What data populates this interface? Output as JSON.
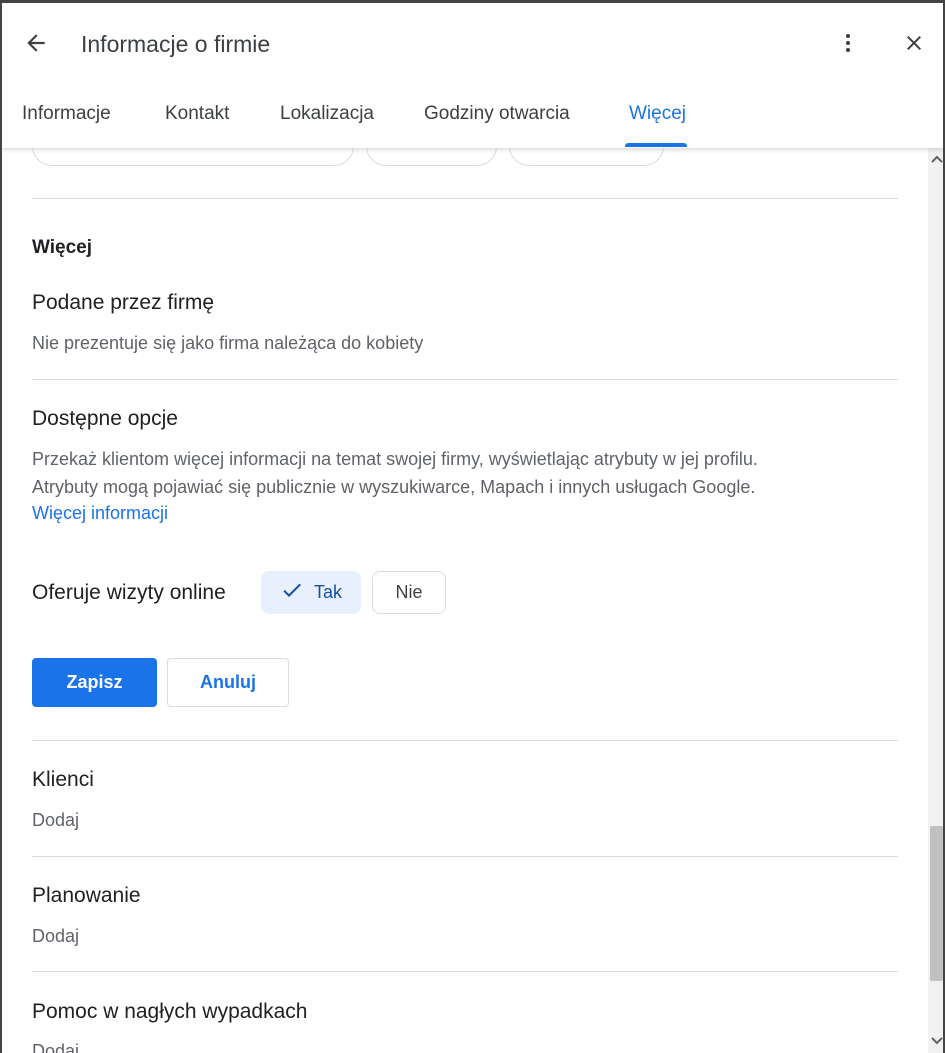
{
  "header": {
    "title": "Informacje o firmie"
  },
  "tabs": [
    {
      "label": "Informacje"
    },
    {
      "label": "Kontakt"
    },
    {
      "label": "Lokalizacja"
    },
    {
      "label": "Godziny otwarcia"
    },
    {
      "label": "Więcej",
      "active": true
    }
  ],
  "more_section": {
    "heading": "Więcej",
    "from_business": {
      "title": "Podane przez firmę",
      "value": "Nie prezentuje się jako firma należąca do kobiety"
    },
    "available_options": {
      "title": "Dostępne opcje",
      "description_line1": "Przekaż klientom więcej informacji na temat swojej firmy, wyświetlając atrybuty w jej profilu.",
      "description_line2": "Atrybuty mogą pojawiać się publicznie w wyszukiwarce, Mapach i innych usługach Google.",
      "link": "Więcej informacji"
    },
    "attribute": {
      "label": "Oferuje wizyty online",
      "yes_label": "Tak",
      "no_label": "Nie",
      "selected": "Tak"
    },
    "save_label": "Zapisz",
    "cancel_label": "Anuluj"
  },
  "sections": [
    {
      "title": "Klienci",
      "value": "Dodaj"
    },
    {
      "title": "Planowanie",
      "value": "Dodaj"
    },
    {
      "title": "Pomoc w nagłych wypadkach",
      "value": "Dodaj"
    }
  ],
  "colors": {
    "accent": "#1a73e8",
    "selected_chip_bg": "#e8f0fe",
    "text_primary": "#202124",
    "text_secondary": "#5f6368",
    "divider": "#dadce0"
  },
  "icons": {
    "back": "arrow-back-icon",
    "more": "more-vert-icon",
    "close": "close-icon",
    "check": "check-icon",
    "scroll_up": "chevron-up-icon",
    "scroll_down": "chevron-down-icon"
  }
}
